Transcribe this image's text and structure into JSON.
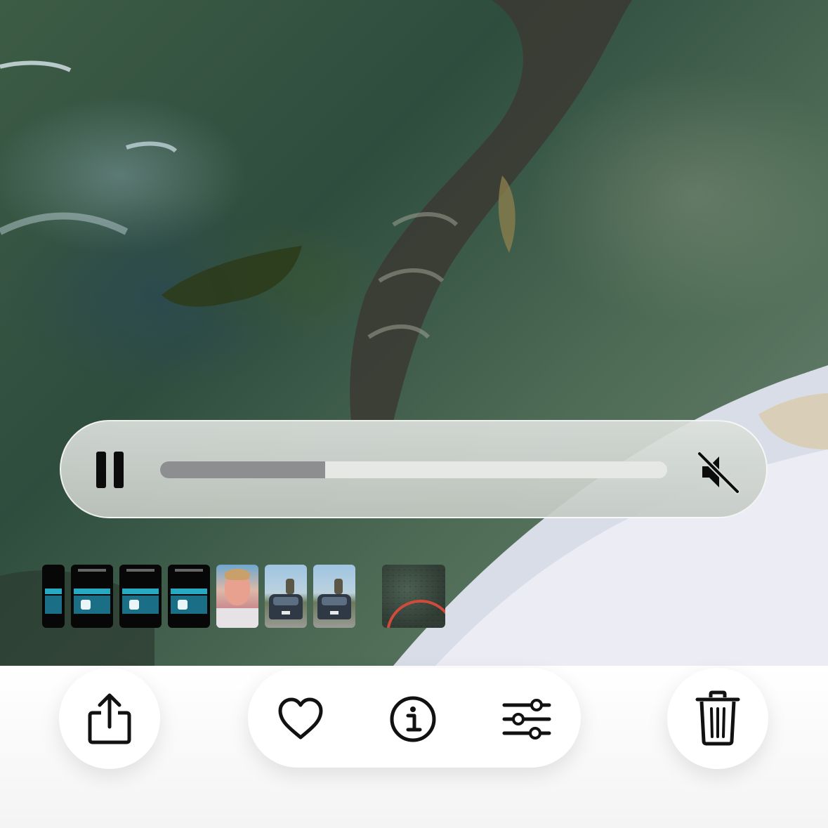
{
  "media": {
    "description_icon": "video-frame"
  },
  "player": {
    "pause_icon": "pause-icon",
    "mute_icon": "speaker-muted-icon",
    "progress": 0.325
  },
  "filmstrip": {
    "items": [
      {
        "kind": "screenshot-partial"
      },
      {
        "kind": "screenshot"
      },
      {
        "kind": "screenshot"
      },
      {
        "kind": "screenshot"
      },
      {
        "kind": "portrait"
      },
      {
        "kind": "car-photo"
      },
      {
        "kind": "car-photo"
      },
      {
        "kind": "current-video"
      }
    ]
  },
  "toolbar": {
    "share_icon": "share-icon",
    "favorite_icon": "heart-icon",
    "info_icon": "info-icon",
    "adjust_icon": "sliders-icon",
    "delete_icon": "trash-icon"
  },
  "colors": {
    "accent_dark": "#0c0c0c",
    "progress_fill": "#8c8e90",
    "progress_track": "#e6e8e6"
  }
}
